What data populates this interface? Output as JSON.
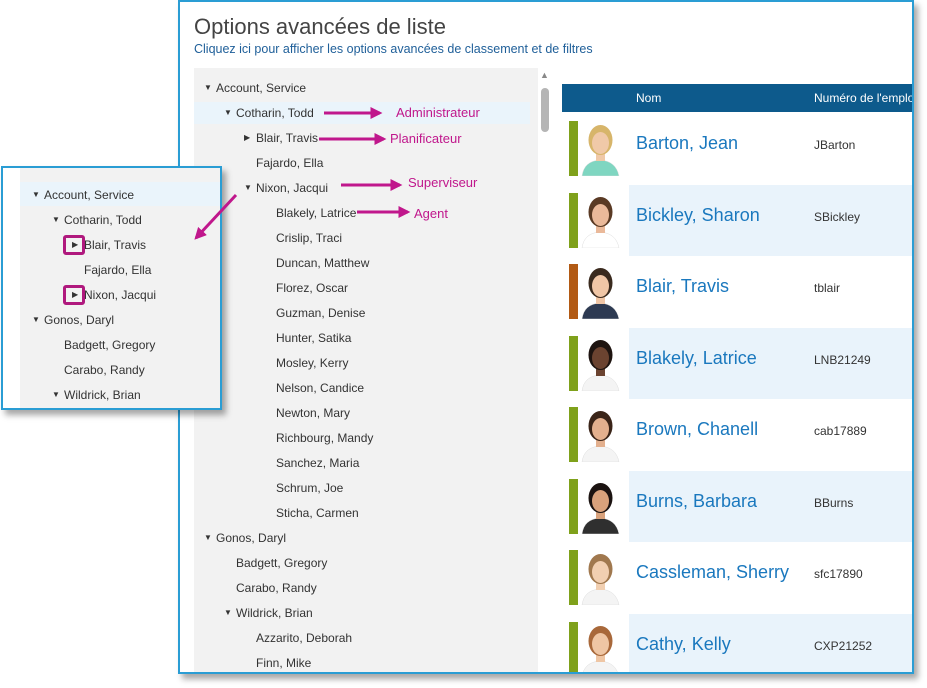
{
  "header": {
    "title": "Options avancées de liste",
    "subtitle": "Cliquez ici pour afficher les options avancées de classement et de filtres"
  },
  "tree": {
    "nodes": [
      {
        "label": "Account, Service",
        "level": 0,
        "expandable": true
      },
      {
        "label": "Cotharin, Todd",
        "level": 1,
        "expandable": true,
        "selected": true
      },
      {
        "label": "Blair, Travis",
        "level": 2,
        "expandable": true,
        "collapsed": true
      },
      {
        "label": "Fajardo, Ella",
        "level": 2,
        "expandable": false
      },
      {
        "label": "Nixon, Jacqui",
        "level": 2,
        "expandable": true
      },
      {
        "label": "Blakely, Latrice",
        "level": 3
      },
      {
        "label": "Crislip, Traci",
        "level": 3
      },
      {
        "label": "Duncan, Matthew",
        "level": 3
      },
      {
        "label": "Florez, Oscar",
        "level": 3
      },
      {
        "label": "Guzman, Denise",
        "level": 3
      },
      {
        "label": "Hunter, Satika",
        "level": 3
      },
      {
        "label": "Mosley, Kerry",
        "level": 3
      },
      {
        "label": "Nelson, Candice",
        "level": 3
      },
      {
        "label": "Newton, Mary",
        "level": 3
      },
      {
        "label": "Richbourg, Mandy",
        "level": 3
      },
      {
        "label": "Sanchez, Maria",
        "level": 3
      },
      {
        "label": "Schrum, Joe",
        "level": 3
      },
      {
        "label": "Sticha, Carmen",
        "level": 3
      },
      {
        "label": "Gonos, Daryl",
        "level": 0,
        "expandable": true
      },
      {
        "label": "Badgett, Gregory",
        "level": 1
      },
      {
        "label": "Carabo, Randy",
        "level": 1
      },
      {
        "label": "Wildrick, Brian",
        "level": 1,
        "expandable": true
      },
      {
        "label": "Azzarito, Deborah",
        "level": 2
      },
      {
        "label": "Finn, Mike",
        "level": 2
      }
    ]
  },
  "grid": {
    "columns": [
      "Nom",
      "Numéro de l'emplo"
    ],
    "rows": [
      {
        "name": "Barton, Jean",
        "id": "JBarton",
        "status_color": "#7fa11b",
        "skin": "#f0c9a8",
        "hair": "#d7b56a",
        "shirt": "#7fd6c1",
        "shaded": false
      },
      {
        "name": "Bickley, Sharon",
        "id": "SBickley",
        "status_color": "#7fa11b",
        "skin": "#eab99a",
        "hair": "#5a3a24",
        "shirt": "#ffffff",
        "shaded": true
      },
      {
        "name": "Blair, Travis",
        "id": "tblair",
        "status_color": "#b25a14",
        "skin": "#f0c6a6",
        "hair": "#3a2a1e",
        "shirt": "#2d3a52",
        "shaded": false
      },
      {
        "name": "Blakely, Latrice",
        "id": "LNB21249",
        "status_color": "#7fa11b",
        "skin": "#6b4330",
        "hair": "#1e1410",
        "shirt": "#f4f4f4",
        "shaded": true
      },
      {
        "name": "Brown, Chanell",
        "id": "cab17889",
        "status_color": "#7fa11b",
        "skin": "#e3b08e",
        "hair": "#3a2418",
        "shirt": "#f4f4f4",
        "shaded": false
      },
      {
        "name": "Burns, Barbara",
        "id": "BBurns",
        "status_color": "#7fa11b",
        "skin": "#d9a27c",
        "hair": "#1b1311",
        "shirt": "#2f2f2f",
        "shaded": true
      },
      {
        "name": "Cassleman, Sherry",
        "id": "sfc17890",
        "status_color": "#7fa11b",
        "skin": "#f1cfb1",
        "hair": "#a0784e",
        "shirt": "#f4f4f4",
        "shaded": false
      },
      {
        "name": "Cathy, Kelly",
        "id": "CXP21252",
        "status_color": "#7fa11b",
        "skin": "#efc6a4",
        "hair": "#a8683a",
        "shirt": "#f4f4f4",
        "shaded": true
      }
    ]
  },
  "zoom": {
    "nodes": [
      {
        "label": "Account, Service",
        "level": 0,
        "caret": "down"
      },
      {
        "label": "Cotharin, Todd",
        "level": 1,
        "caret": "down"
      },
      {
        "label": "Blair, Travis",
        "level": 2,
        "caret": "right",
        "boxed": true
      },
      {
        "label": "Fajardo, Ella",
        "level": 2,
        "caret": "none"
      },
      {
        "label": "Nixon, Jacqui",
        "level": 2,
        "caret": "right",
        "boxed": true
      },
      {
        "label": "Gonos, Daryl",
        "level": 0,
        "caret": "down"
      },
      {
        "label": "Badgett, Gregory",
        "level": 1,
        "caret": "none"
      },
      {
        "label": "Carabo, Randy",
        "level": 1,
        "caret": "none"
      },
      {
        "label": "Wildrick, Brian",
        "level": 1,
        "caret": "down"
      }
    ]
  },
  "annotations": {
    "administrateur": "Administrateur",
    "planificateur": "Planificateur",
    "superviseur": "Superviseur",
    "agent": "Agent"
  },
  "colors": {
    "accent": "#2a9dd4",
    "header": "#0d5a8c",
    "link": "#1a78be",
    "annotation": "#c0178c"
  }
}
